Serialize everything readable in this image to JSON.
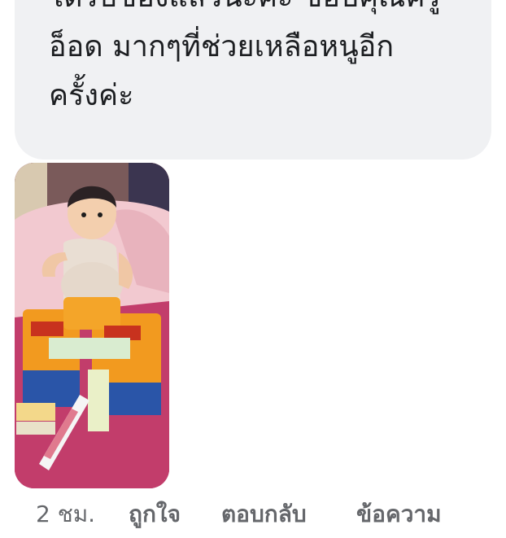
{
  "message": {
    "lines": [
      "ได้รับของแล้วน่ะค่ะ ขอบคุณครู",
      "อ็อด มากๆที่ช่วยเหลือหนูอีก",
      "ครั้งค่ะ"
    ]
  },
  "photo": {
    "alt": ""
  },
  "meta": {
    "time": "2 ชม.",
    "like_label": "ถูกใจ",
    "reply_label": "ตอบกลับ",
    "message_label": "ข้อความ"
  },
  "colors": {
    "bubble_bg": "#f0f1f3",
    "text": "#1c1e21",
    "meta_text": "#65676b"
  }
}
